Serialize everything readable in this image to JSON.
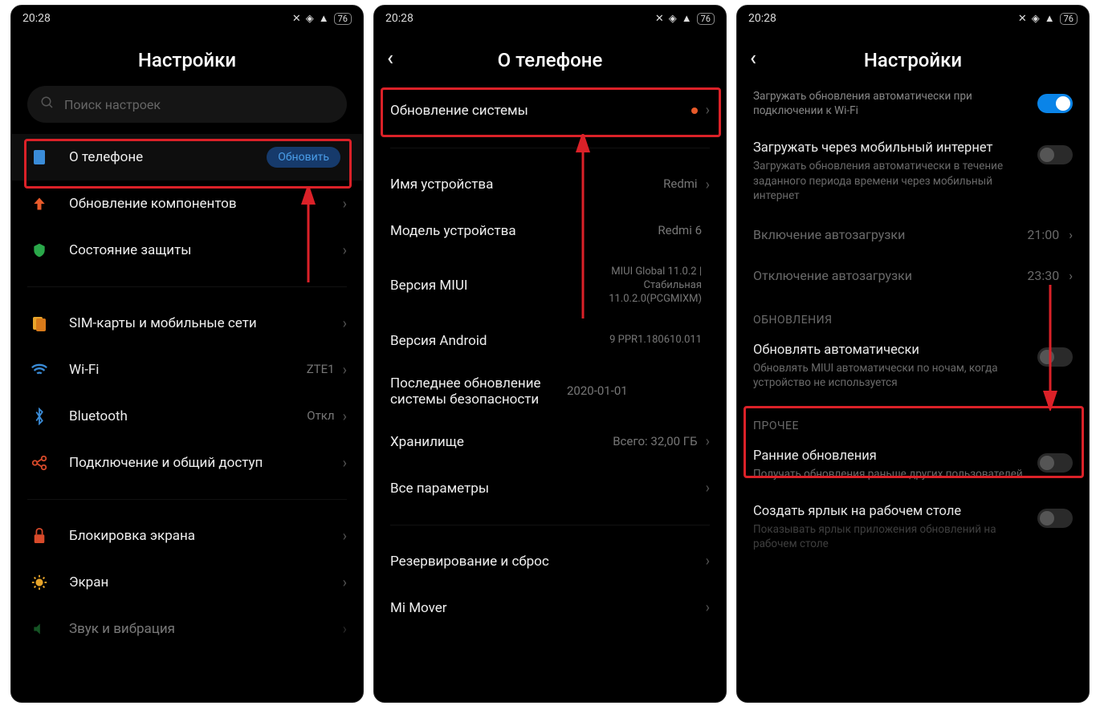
{
  "statusbar": {
    "time": "20:28",
    "battery": "76"
  },
  "screen1": {
    "title": "Настройки",
    "search_placeholder": "Поиск настроек",
    "about": {
      "label": "О телефоне",
      "badge": "Обновить"
    },
    "items": [
      {
        "label": "Обновление компонентов"
      },
      {
        "label": "Состояние защиты"
      }
    ],
    "group2": [
      {
        "label": "SIM-карты и мобильные сети"
      },
      {
        "label": "Wi-Fi",
        "value": "ZTE1"
      },
      {
        "label": "Bluetooth",
        "value": "Откл"
      },
      {
        "label": "Подключение и общий доступ"
      }
    ],
    "group3": [
      {
        "label": "Блокировка экрана"
      },
      {
        "label": "Экран"
      },
      {
        "label": "Звук и вибрация"
      }
    ]
  },
  "screen2": {
    "title": "О телефоне",
    "system_update": "Обновление системы",
    "rows": [
      {
        "label": "Имя устройства",
        "value": "Redmi"
      },
      {
        "label": "Модель устройства",
        "value": "Redmi 6"
      },
      {
        "label": "Версия MIUI",
        "value": "MIUI Global 11.0.2 | Стабильная 11.0.2.0(PCGMIXM)"
      },
      {
        "label": "Версия Android",
        "value": "9 PPR1.180610.011"
      },
      {
        "label": "Последнее обновление системы безопасности",
        "value": "2020-01-01"
      },
      {
        "label": "Хранилище",
        "value": "Всего: 32,00 ГБ"
      },
      {
        "label": "Все параметры",
        "value": ""
      }
    ],
    "rows2": [
      {
        "label": "Резервирование и сброс"
      },
      {
        "label": "Mi Mover"
      }
    ]
  },
  "screen3": {
    "title": "Настройки",
    "wifi_dl": {
      "title": "",
      "sub": "Загружать обновления автоматически при подключении к Wi-Fi",
      "on": true
    },
    "mobile_dl": {
      "title": "Загружать через мобильный интернет",
      "sub": "Загружать обновления автоматически в течение заданного периода времени через мобильный интернет",
      "on": false
    },
    "autoload_on": {
      "label": "Включение автозагрузки",
      "value": "21:00"
    },
    "autoload_off": {
      "label": "Отключение автозагрузки",
      "value": "23:30"
    },
    "sect_updates": "ОБНОВЛЕНИЯ",
    "auto_update": {
      "title": "Обновлять автоматически",
      "sub": "Обновлять MIUI автоматически по ночам, когда устройство не используется",
      "on": false
    },
    "sect_other": "ПРОЧЕЕ",
    "early": {
      "title": "Ранние обновления",
      "sub": "Получать обновления раньше других пользователей",
      "on": false
    },
    "shortcut": {
      "title": "Создать ярлык на рабочем столе",
      "sub": "Показывать ярлык приложения обновлений на рабочем столе",
      "on": false
    }
  }
}
